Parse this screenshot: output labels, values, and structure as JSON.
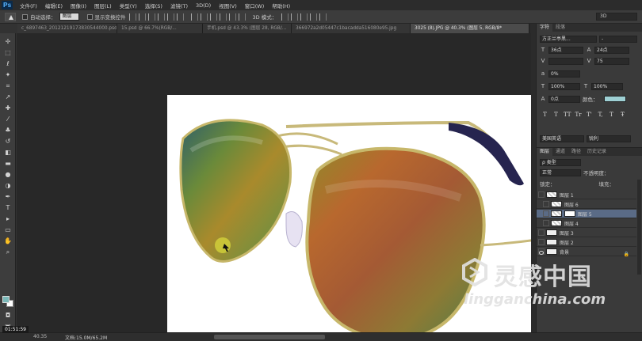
{
  "app": {
    "logo": "Ps"
  },
  "menu": [
    "文件(F)",
    "编辑(E)",
    "图像(I)",
    "图层(L)",
    "类型(Y)",
    "选择(S)",
    "滤镜(T)",
    "3D(D)",
    "视图(V)",
    "窗口(W)",
    "帮助(H)"
  ],
  "options": {
    "auto_select_label": "自动选择：",
    "auto_select_value": "图层",
    "show_transform_label": "显示变换控件",
    "mode_3d_label": "3D 模式：",
    "workspace": "3D"
  },
  "tabs": [
    {
      "label": "c_6897463_20121219173830544000.psd",
      "active": false
    },
    {
      "label": "15.psd @ 66.7%(RGB/...",
      "active": false
    },
    {
      "label": "手机.psd @ 43.3% (图层 28, RGB/...",
      "active": false
    },
    {
      "label": "366972a2d05447c1bacadda516080e95.jpg",
      "active": false
    },
    {
      "label": "3025 (8).JPG @ 40.3% (图层 5, RGB/8*",
      "active": true
    }
  ],
  "character": {
    "tabs": [
      "字符",
      "段落"
    ],
    "font_family": "方正兰亭黑...",
    "font_style": "-",
    "font_size": "36点",
    "leading": "24点",
    "kerning": "",
    "tracking": "75",
    "vertical_shift": "0%",
    "vertical_scale": "100%",
    "horizontal_scale": "100%",
    "baseline": "0点",
    "color_label": "颜色：",
    "color": "#9ed0d4",
    "format_buttons": [
      "T",
      "T",
      "TT",
      "Tr",
      "T'",
      "T,",
      "T",
      "Ŧ"
    ],
    "language": "美国英语",
    "antialias": "锐利"
  },
  "layers": {
    "tabs": [
      "图层",
      "通道",
      "路径",
      "历史记录"
    ],
    "filter": "ρ 类型",
    "blend_mode": "正常",
    "opacity_label": "不透明度：",
    "lock_label": "锁定：",
    "fill_label": "填充：",
    "items": [
      {
        "name": "图层 1",
        "visible": false,
        "selected": false
      },
      {
        "name": "图层 6",
        "visible": false,
        "selected": false
      },
      {
        "name": "图层 5",
        "visible": false,
        "selected": true
      },
      {
        "name": "图层 4",
        "visible": false,
        "selected": false
      },
      {
        "name": "图层 3",
        "visible": false,
        "selected": false
      },
      {
        "name": "图层 2",
        "visible": false,
        "selected": false
      },
      {
        "name": "背景",
        "visible": true,
        "selected": false
      }
    ]
  },
  "status": {
    "timestamp": "01:51:59",
    "zoom": "40.35",
    "doc_info": "文档:15.0M/65.2M"
  },
  "watermark": {
    "cn": "灵感中国",
    "en": "lingganchina.com"
  }
}
